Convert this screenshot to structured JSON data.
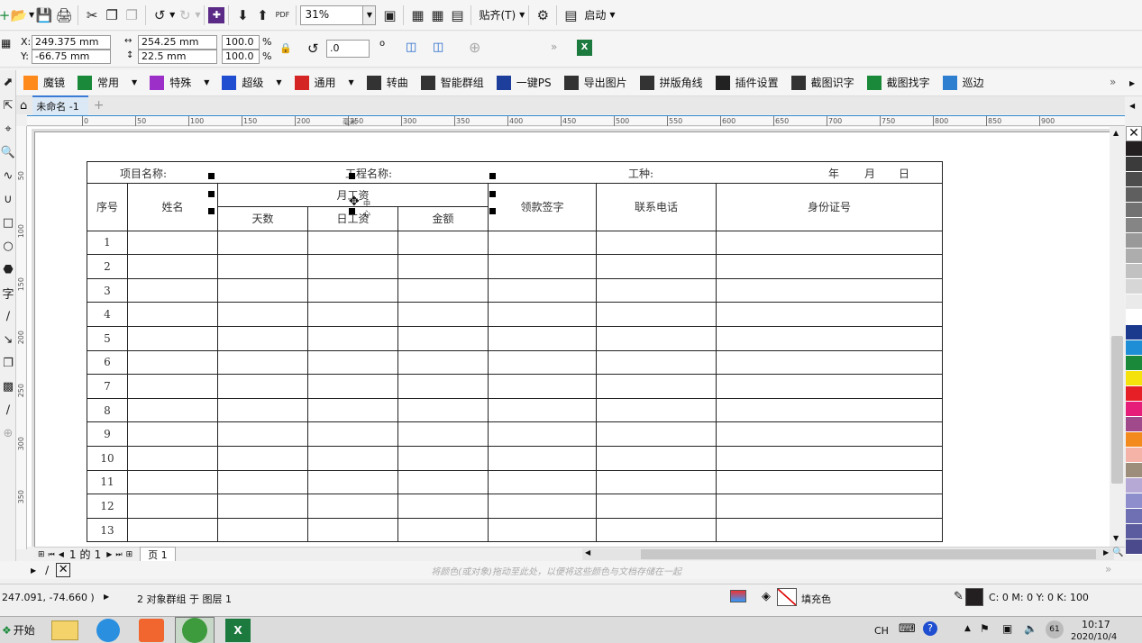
{
  "toolbar": {
    "pdf_label": "PDF",
    "zoom": "31%",
    "snap_label": "贴齐(T)",
    "launch_label": "启动"
  },
  "props": {
    "x_label": "X:",
    "x_value": "249.375 mm",
    "y_label": "Y:",
    "y_value": "-66.75 mm",
    "w_value": "254.25 mm",
    "h_value": "22.5 mm",
    "sx": "100.0",
    "sy": "100.0",
    "pct": "%",
    "angle": ".0",
    "deg": "o"
  },
  "plugins": [
    {
      "label": "魔镜",
      "color": "#ff8a1c"
    },
    {
      "label": "常用",
      "color": "#1a8a3a",
      "dd": true
    },
    {
      "label": "特殊",
      "color": "#9b2fc8",
      "dd": true
    },
    {
      "label": "超级",
      "color": "#1f4fd0",
      "dd": true
    },
    {
      "label": "通用",
      "color": "#d42424",
      "dd": true
    },
    {
      "label": "转曲",
      "color": "#333333"
    },
    {
      "label": "智能群组",
      "color": "#333333"
    },
    {
      "label": "一键PS",
      "color": "#1e3e9c"
    },
    {
      "label": "导出图片",
      "color": "#333333"
    },
    {
      "label": "拼版角线",
      "color": "#333333"
    },
    {
      "label": "插件设置",
      "color": "#222222"
    },
    {
      "label": "截图识字",
      "color": "#333333"
    },
    {
      "label": "截图找字",
      "color": "#1a8a3a"
    },
    {
      "label": "巡边",
      "color": "#2f7fd0"
    }
  ],
  "doc_tab": "未命名 -1",
  "ruler": {
    "top": [
      "0",
      "50",
      "100",
      "150",
      "200",
      "250",
      "300",
      "350",
      "400",
      "450",
      "500",
      "550",
      "600",
      "650",
      "700",
      "750",
      "800",
      "850",
      "900"
    ],
    "unit": "毫米",
    "left": [
      "50",
      "100",
      "150",
      "200",
      "250",
      "300",
      "350"
    ]
  },
  "sheet": {
    "project": "项目名称:",
    "engineering": "工程名称:",
    "trade": "工种:",
    "year": "年",
    "month": "月",
    "day": "日",
    "col_no": "序号",
    "col_name": "姓名",
    "col_wage": "月工资",
    "col_days": "天数",
    "col_daily": "日工资",
    "col_amount": "金额",
    "col_sign": "领款签字",
    "col_phone": "联系电话",
    "col_id": "身份证号",
    "rows": [
      "1",
      "2",
      "3",
      "4",
      "5",
      "6",
      "7",
      "8",
      "9",
      "10",
      "11",
      "12",
      "13"
    ],
    "cursor_tip": "中心"
  },
  "pagebar": {
    "current": "1",
    "of": "的",
    "total": "1",
    "tab": "页 1"
  },
  "hint": "将颜色(或对象)拖动至此处，以便将这些颜色与文档存储在一起",
  "status": {
    "coords": "247.091, -74.660 )",
    "selection": "2 对象群组 于 图层 1",
    "fill_label": "填充色",
    "outline_color": "C: 0 M: 0 Y: 0 K: 100"
  },
  "taskbar": {
    "start": "开始",
    "lang": "CH",
    "time": "10:17",
    "date": "2020/10/4",
    "badge": "61"
  },
  "palette": [
    "#231f20",
    "#3b3b3b",
    "#4d4d4d",
    "#5f5f5f",
    "#727272",
    "#858585",
    "#999999",
    "#adadad",
    "#c1c1c1",
    "#d6d6d6",
    "#eaeaea",
    "#ffffff",
    "#1b3a8e",
    "#1e8fd6",
    "#1a8a3a",
    "#f5e10c",
    "#e61e26",
    "#e61e7a",
    "#a14a8b",
    "#f28a1e",
    "#f5b2a6",
    "#9c8e7a",
    "#b7a9d6",
    "#8e8ecc",
    "#6f6fb4",
    "#5b5ba0",
    "#4a4a8c"
  ]
}
